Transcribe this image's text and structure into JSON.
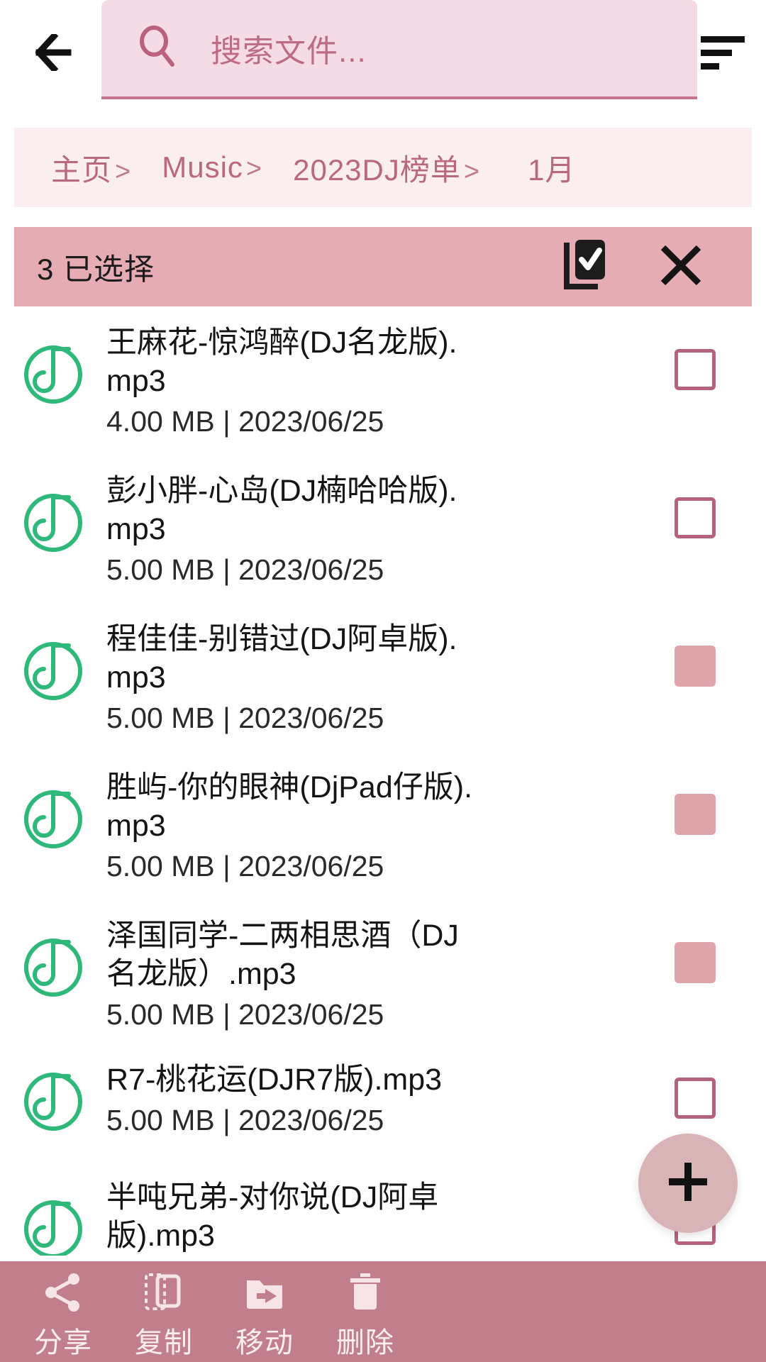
{
  "topbar": {
    "back_icon": "arrow-left-icon",
    "search_placeholder": "搜索文件...",
    "search_value": "",
    "search_icon": "search-icon",
    "sort_icon": "sort-icon"
  },
  "breadcrumb": {
    "separator": ">",
    "items": [
      {
        "label": "主页"
      },
      {
        "label": "Music"
      },
      {
        "label": "2023DJ榜单"
      },
      {
        "label": "1月"
      }
    ]
  },
  "selection_bar": {
    "count_text": "3 已选择",
    "select_all_icon": "select-all-checkbox-icon",
    "close_icon": "close-icon",
    "background": "#e5acb4"
  },
  "files": [
    {
      "name": "王麻花-惊鸿醉(DJ名龙版).mp3",
      "size": "4.00 MB",
      "date": "2023/06/25",
      "sub": "4.00 MB | 2023/06/25",
      "selected": false,
      "icon": "music-file-icon"
    },
    {
      "name": "彭小胖-心岛(DJ楠哈哈版).mp3",
      "size": "5.00 MB",
      "date": "2023/06/25",
      "sub": "5.00 MB | 2023/06/25",
      "selected": false,
      "icon": "music-file-icon"
    },
    {
      "name": "程佳佳-别错过(DJ阿卓版).mp3",
      "size": "5.00 MB",
      "date": "2023/06/25",
      "sub": "5.00 MB | 2023/06/25",
      "selected": true,
      "icon": "music-file-icon"
    },
    {
      "name": "胜屿-你的眼神(DjPad仔版).mp3",
      "size": "5.00 MB",
      "date": "2023/06/25",
      "sub": "5.00 MB | 2023/06/25",
      "selected": true,
      "icon": "music-file-icon"
    },
    {
      "name": "泽国同学-二两相思酒（DJ名龙版）.mp3",
      "size": "5.00 MB",
      "date": "2023/06/25",
      "sub": "5.00 MB | 2023/06/25",
      "selected": true,
      "icon": "music-file-icon"
    },
    {
      "name": "R7-桃花运(DJR7版).mp3",
      "size": "5.00 MB",
      "date": "2023/06/25",
      "sub": "5.00 MB | 2023/06/25",
      "selected": false,
      "icon": "music-file-icon"
    },
    {
      "name": "半吨兄弟-对你说(DJ阿卓版).mp3",
      "size": "",
      "date": "",
      "sub": "",
      "selected": false,
      "icon": "music-file-icon"
    }
  ],
  "fab": {
    "icon": "plus-icon",
    "color": "#d9b4b6"
  },
  "bottom_actions": [
    {
      "label": "分享",
      "icon": "share-icon"
    },
    {
      "label": "复制",
      "icon": "copy-icon"
    },
    {
      "label": "移动",
      "icon": "move-folder-icon"
    },
    {
      "label": "删除",
      "icon": "trash-icon"
    }
  ],
  "colors": {
    "accent_pink": "#b9697f",
    "search_bg": "#f5dbe5",
    "breadcrumb_bg": "#fbeef1",
    "selection_bg": "#e5acb4",
    "bottom_bar_bg": "#c17e8b",
    "music_icon_green": "#2eb87a",
    "checkbox_border": "#b5637c",
    "checkbox_checked": "#e0a5ab"
  }
}
